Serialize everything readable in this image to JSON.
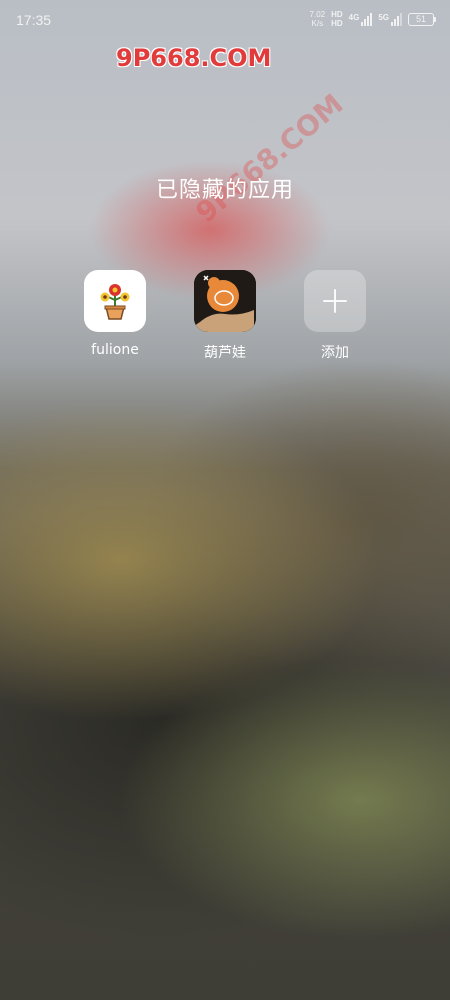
{
  "status_bar": {
    "time": "17:35",
    "net_speed_value": "7.02",
    "net_speed_unit": "K/s",
    "hd1": "HD",
    "hd2": "HD",
    "sim1_label": "4G",
    "sim2_label": "5G",
    "battery": "51"
  },
  "watermark": {
    "top": "9P668.COM",
    "diagonal": "9P668.COM"
  },
  "page": {
    "title": "已隐藏的应用"
  },
  "apps": [
    {
      "label": "fulione",
      "icon": "flower-pot-icon"
    },
    {
      "label": "葫芦娃",
      "icon": "calabash-icon"
    },
    {
      "label": "添加",
      "icon": "plus-icon"
    }
  ],
  "colors": {
    "watermark": "#e23b3b",
    "text": "#ffffff"
  }
}
